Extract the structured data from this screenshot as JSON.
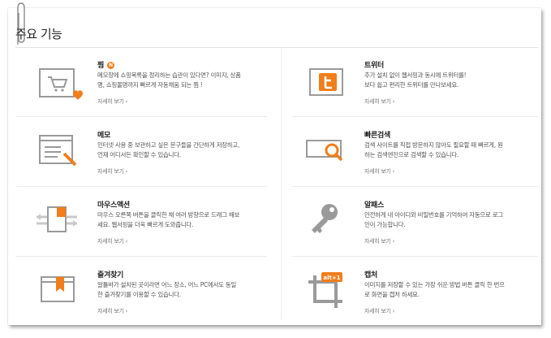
{
  "page": {
    "title": "주요 기능"
  },
  "colors": {
    "accent": "#f07e1b",
    "icon_gray": "#9a9a9a"
  },
  "features": [
    {
      "name": "찜",
      "badge": "N",
      "icon": "cart-heart-icon",
      "desc_lines": [
        "메모장에 쇼핑목록을 정리하는 습관이 있다면? 이미지, 상품",
        "명, 쇼핑몰명까지 빠르게 자동채움 되는 찜 !"
      ],
      "more": "자세히 보기 ›"
    },
    {
      "name": "트위터",
      "icon": "twitter-icon",
      "desc_lines": [
        "추가 설치 없이 웹서핑과 동시에 트위터를!",
        "보다 쉽고 편리한 트위터를 만나보세요."
      ],
      "more": "자세히 보기 ›"
    },
    {
      "name": "메모",
      "icon": "memo-icon",
      "desc_lines": [
        "인터넷 사용 중 보관하고 싶은 문구들을 간단하게 저장하고,",
        "언제 어디서든 확인할 수 있습니다."
      ],
      "more": "자세히 보기 ›"
    },
    {
      "name": "빠른검색",
      "icon": "quick-search-icon",
      "desc_lines": [
        "검색 사이트를 직접 방문하지 않아도 필요할 때 빠르게, 원",
        "하는 검색엔진으로 검색할 수 있습니다."
      ],
      "more": "자세히 보기 ›"
    },
    {
      "name": "마우스액션",
      "icon": "mouse-action-icon",
      "desc_lines": [
        "마우스 오른쪽 버튼을 클릭한 채 여러 방향으로 드래그 해보",
        "세요. 웹서핑을 더욱 빠르게 도와줍니다."
      ],
      "more": "자세히 보기 ›"
    },
    {
      "name": "알패스",
      "icon": "key-icon",
      "desc_lines": [
        "안전하게 내 아이디와 비밀번호를 기억하여 자동으로 로그",
        "인이 가능합니다."
      ],
      "more": "자세히 보기 ›"
    },
    {
      "name": "즐겨찾기",
      "icon": "bookmark-icon",
      "desc_lines": [
        "알툴바가 설치된 곳이라면 어느 장소, 어느 PC에서도 동일",
        "한 즐겨찾기를 이용할 수 있습니다."
      ],
      "more": "자세히 보기 ›"
    },
    {
      "name": "캡처",
      "icon": "capture-crop-icon",
      "shortcut": "alt+1",
      "desc_lines": [
        "이미지를 저장할 수 있는 가장 쉬운 방법 버튼 클릭 한 번으",
        "로 화면을 캡처 하세요."
      ],
      "more": "자세히 보기 ›"
    }
  ]
}
